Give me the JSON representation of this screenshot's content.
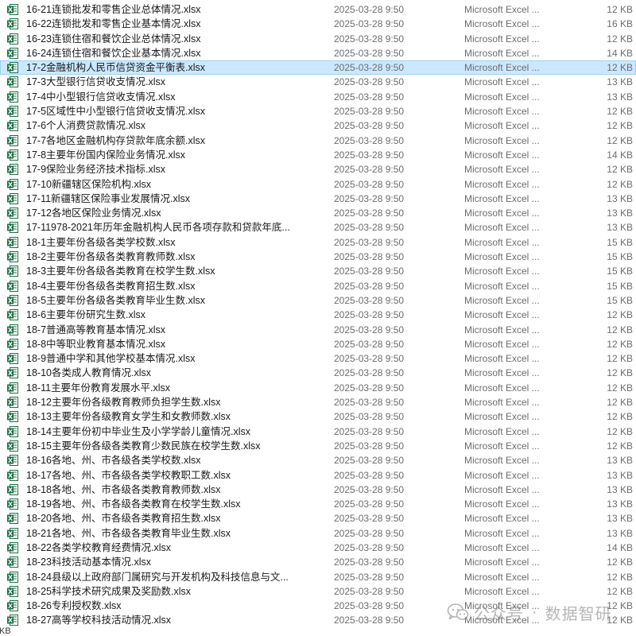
{
  "files": [
    {
      "name": "16-21连锁批发和零售企业总体情况.xlsx",
      "date": "2025-03-28 9:50",
      "type": "Microsoft Excel ...",
      "size": "12 KB"
    },
    {
      "name": "16-22连锁批发和零售企业基本情况.xlsx",
      "date": "2025-03-28 9:50",
      "type": "Microsoft Excel ...",
      "size": "16 KB"
    },
    {
      "name": "16-23连锁住宿和餐饮企业总体情况.xlsx",
      "date": "2025-03-28 9:50",
      "type": "Microsoft Excel ...",
      "size": "12 KB"
    },
    {
      "name": "16-24连锁住宿和餐饮企业基本情况.xlsx",
      "date": "2025-03-28 9:50",
      "type": "Microsoft Excel ...",
      "size": "14 KB"
    },
    {
      "name": "17-2金融机构人民币信贷资金平衡表.xlsx",
      "date": "2025-03-28 9:50",
      "type": "Microsoft Excel ...",
      "size": "12 KB",
      "selected": true
    },
    {
      "name": "17-3大型银行信贷收支情况.xlsx",
      "date": "2025-03-28 9:50",
      "type": "Microsoft Excel ...",
      "size": "13 KB"
    },
    {
      "name": "17-4中小型银行信贷收支情况.xlsx",
      "date": "2025-03-28 9:50",
      "type": "Microsoft Excel ...",
      "size": "13 KB"
    },
    {
      "name": "17-5区域性中小型银行信贷收支情况.xlsx",
      "date": "2025-03-28 9:50",
      "type": "Microsoft Excel ...",
      "size": "12 KB"
    },
    {
      "name": "17-6个人消费贷款情况.xlsx",
      "date": "2025-03-28 9:50",
      "type": "Microsoft Excel ...",
      "size": "12 KB"
    },
    {
      "name": "17-7各地区金融机构存贷款年底余额.xlsx",
      "date": "2025-03-28 9:50",
      "type": "Microsoft Excel ...",
      "size": "12 KB"
    },
    {
      "name": "17-8主要年份国内保险业务情况.xlsx",
      "date": "2025-03-28 9:50",
      "type": "Microsoft Excel ...",
      "size": "14 KB"
    },
    {
      "name": "17-9保险业务经济技术指标.xlsx",
      "date": "2025-03-28 9:50",
      "type": "Microsoft Excel ...",
      "size": "12 KB"
    },
    {
      "name": "17-10新疆辖区保险机构.xlsx",
      "date": "2025-03-28 9:50",
      "type": "Microsoft Excel ...",
      "size": "12 KB"
    },
    {
      "name": "17-11新疆辖区保险事业发展情况.xlsx",
      "date": "2025-03-28 9:50",
      "type": "Microsoft Excel ...",
      "size": "13 KB"
    },
    {
      "name": "17-12各地区保险业务情况.xlsx",
      "date": "2025-03-28 9:50",
      "type": "Microsoft Excel ...",
      "size": "13 KB"
    },
    {
      "name": "17-11978-2021年历年金融机构人民币各项存款和贷款年底...",
      "date": "2025-03-28 9:50",
      "type": "Microsoft Excel ...",
      "size": "13 KB"
    },
    {
      "name": "18-1主要年份各级各类学校数.xlsx",
      "date": "2025-03-28 9:50",
      "type": "Microsoft Excel ...",
      "size": "15 KB"
    },
    {
      "name": "18-2主要年份各级各类教育教师数.xlsx",
      "date": "2025-03-28 9:50",
      "type": "Microsoft Excel ...",
      "size": "15 KB"
    },
    {
      "name": "18-3主要年份各级各类教育在校学生数.xlsx",
      "date": "2025-03-28 9:50",
      "type": "Microsoft Excel ...",
      "size": "15 KB"
    },
    {
      "name": "18-4主要年份各级各类教育招生数.xlsx",
      "date": "2025-03-28 9:50",
      "type": "Microsoft Excel ...",
      "size": "15 KB"
    },
    {
      "name": "18-5主要年份各级各类教育毕业生数.xlsx",
      "date": "2025-03-28 9:50",
      "type": "Microsoft Excel ...",
      "size": "15 KB"
    },
    {
      "name": "18-6主要年份研究生数.xlsx",
      "date": "2025-03-28 9:50",
      "type": "Microsoft Excel ...",
      "size": "12 KB"
    },
    {
      "name": "18-7普通高等教育基本情况.xlsx",
      "date": "2025-03-28 9:50",
      "type": "Microsoft Excel ...",
      "size": "12 KB"
    },
    {
      "name": "18-8中等职业教育基本情况.xlsx",
      "date": "2025-03-28 9:50",
      "type": "Microsoft Excel ...",
      "size": "12 KB"
    },
    {
      "name": "18-9普通中学和其他学校基本情况.xlsx",
      "date": "2025-03-28 9:50",
      "type": "Microsoft Excel ...",
      "size": "12 KB"
    },
    {
      "name": "18-10各类成人教育情况.xlsx",
      "date": "2025-03-28 9:50",
      "type": "Microsoft Excel ...",
      "size": "12 KB"
    },
    {
      "name": "18-11主要年份教育发展水平.xlsx",
      "date": "2025-03-28 9:50",
      "type": "Microsoft Excel ...",
      "size": "12 KB"
    },
    {
      "name": "18-12主要年份各级教育教师负担学生数.xlsx",
      "date": "2025-03-28 9:50",
      "type": "Microsoft Excel ...",
      "size": "12 KB"
    },
    {
      "name": "18-13主要年份各级教育女学生和女教师数.xlsx",
      "date": "2025-03-28 9:50",
      "type": "Microsoft Excel ...",
      "size": "12 KB"
    },
    {
      "name": "18-14主要年份初中毕业生及小学学龄儿童情况.xlsx",
      "date": "2025-03-28 9:50",
      "type": "Microsoft Excel ...",
      "size": "12 KB"
    },
    {
      "name": "18-15主要年份各级各类教育少数民族在校学生数.xlsx",
      "date": "2025-03-28 9:50",
      "type": "Microsoft Excel ...",
      "size": "12 KB"
    },
    {
      "name": "18-16各地、州、市各级各类学校数.xlsx",
      "date": "2025-03-28 9:50",
      "type": "Microsoft Excel ...",
      "size": "13 KB"
    },
    {
      "name": "18-17各地、州、市各级各类学校教职工数.xlsx",
      "date": "2025-03-28 9:50",
      "type": "Microsoft Excel ...",
      "size": "13 KB"
    },
    {
      "name": "18-18各地、州、市各级各类教育教师数.xlsx",
      "date": "2025-03-28 9:50",
      "type": "Microsoft Excel ...",
      "size": "13 KB"
    },
    {
      "name": "18-19各地、州、市各级各类教育在校学生数.xlsx",
      "date": "2025-03-28 9:50",
      "type": "Microsoft Excel ...",
      "size": "13 KB"
    },
    {
      "name": "18-20各地、州、市各级各类教育招生数.xlsx",
      "date": "2025-03-28 9:50",
      "type": "Microsoft Excel ...",
      "size": "13 KB"
    },
    {
      "name": "18-21各地、州、市各级各类教育毕业生数.xlsx",
      "date": "2025-03-28 9:50",
      "type": "Microsoft Excel ...",
      "size": "13 KB"
    },
    {
      "name": "18-22各类学校教育经费情况.xlsx",
      "date": "2025-03-28 9:50",
      "type": "Microsoft Excel ...",
      "size": "14 KB"
    },
    {
      "name": "18-23科技活动基本情况.xlsx",
      "date": "2025-03-28 9:50",
      "type": "Microsoft Excel ...",
      "size": "12 KB"
    },
    {
      "name": "18-24县级以上政府部门属研究与开发机构及科技信息与文...",
      "date": "2025-03-28 9:50",
      "type": "Microsoft Excel ...",
      "size": "12 KB"
    },
    {
      "name": "18-25科学技术研究成果及奖励数.xlsx",
      "date": "2025-03-28 9:50",
      "type": "Microsoft Excel ...",
      "size": "12 KB"
    },
    {
      "name": "18-26专利授权数.xlsx",
      "date": "2025-03-28 9:50",
      "type": "Microsoft Excel ...",
      "size": "12 KB"
    },
    {
      "name": "18-27高等学校科技活动情况.xlsx",
      "date": "2025-03-28 9:50",
      "type": "Microsoft Excel ...",
      "size": "12 KB"
    }
  ],
  "status_fragment": "KB",
  "watermark": {
    "logo_icon": "wechat-icon",
    "left_text": "公众号",
    "right_text": "数据智研"
  },
  "colors": {
    "excel_green": "#1d7044",
    "selected_bg": "#cce8ff",
    "muted_text": "#6d6d6d"
  }
}
